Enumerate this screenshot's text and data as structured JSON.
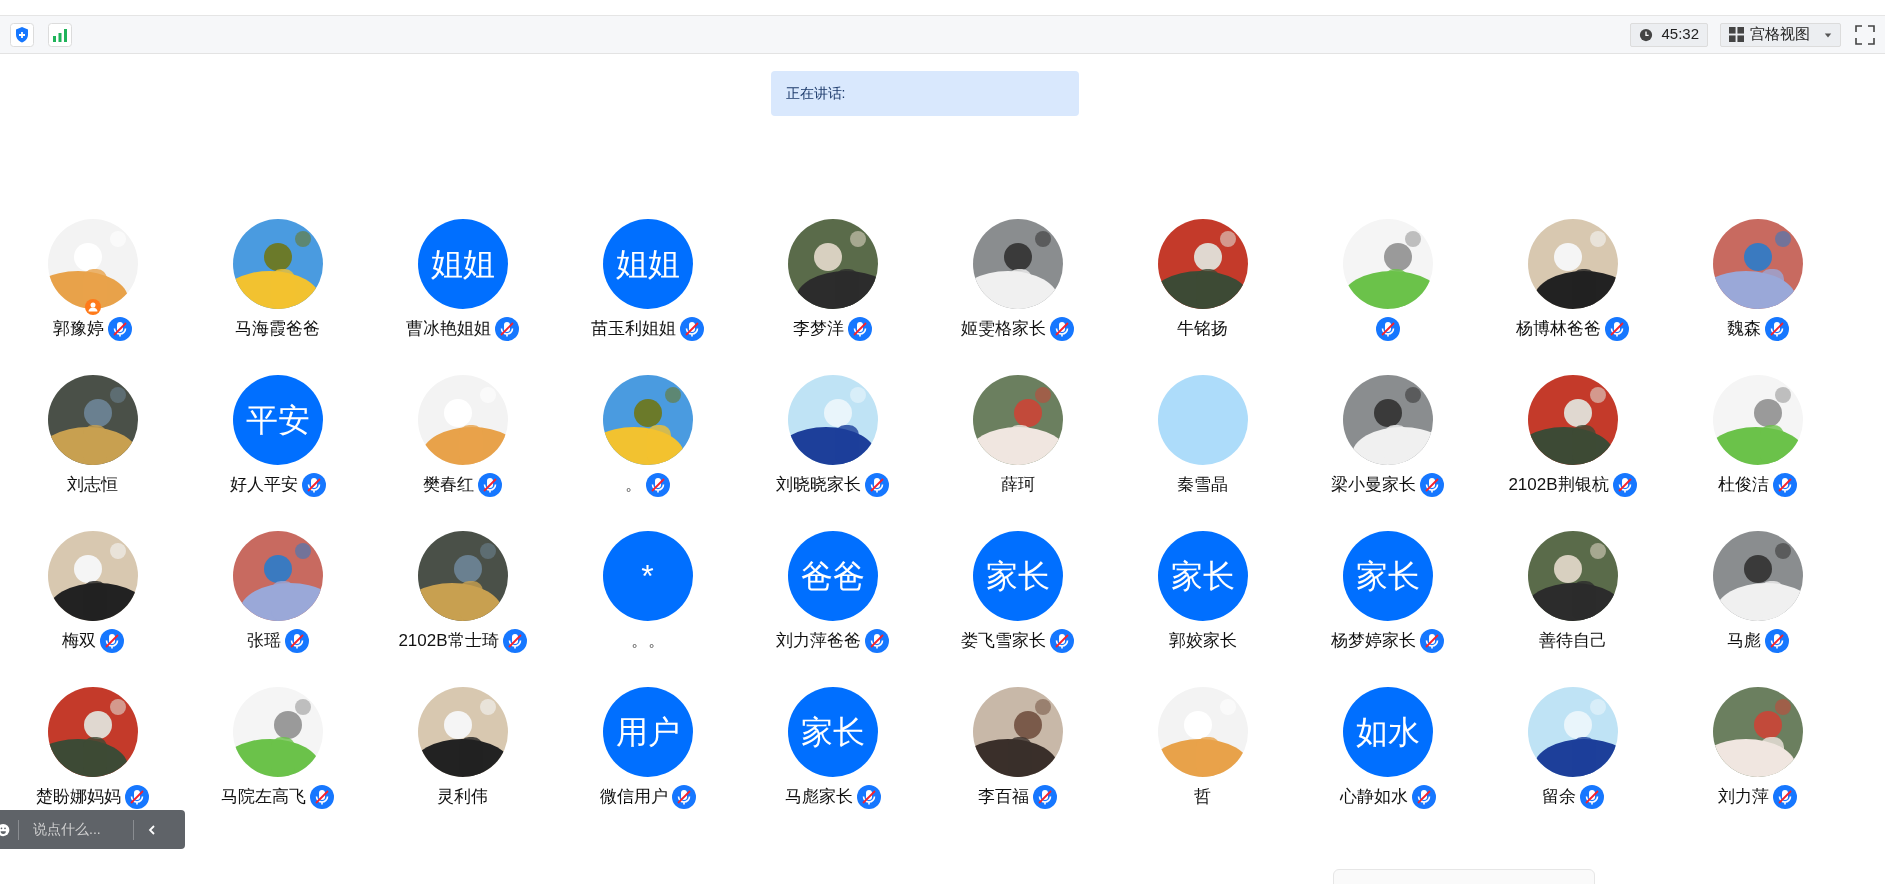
{
  "toolbar": {
    "timer": "45:32",
    "view_button": "宫格视图"
  },
  "speaking": {
    "label": "正在讲话:"
  },
  "participants": [
    {
      "name": "郭豫婷",
      "muted": true,
      "host": true
    },
    {
      "name": "马海霞爸爸",
      "muted": false,
      "host": false
    },
    {
      "name": "曹冰艳姐姐",
      "avatar": {
        "kind": "text",
        "text": "姐姐"
      },
      "muted": true,
      "host": false
    },
    {
      "name": "苗玉利姐姐",
      "avatar": {
        "kind": "text",
        "text": "姐姐"
      },
      "muted": true,
      "host": false
    },
    {
      "name": "李梦洋",
      "muted": true,
      "host": false
    },
    {
      "name": "姬雯格家长",
      "muted": true,
      "host": false
    },
    {
      "name": "牛铭扬",
      "muted": false,
      "host": false
    },
    {
      "muted": true,
      "host": false
    },
    {
      "name": "杨博林爸爸",
      "muted": true,
      "host": false
    },
    {
      "name": "魏森",
      "muted": true,
      "host": false
    },
    {
      "name": "刘志恒",
      "muted": false,
      "host": false
    },
    {
      "name": "好人平安",
      "avatar": {
        "kind": "text",
        "text": "平安"
      },
      "muted": true,
      "host": false
    },
    {
      "name": "樊春红",
      "muted": true,
      "host": false
    },
    {
      "name": "。",
      "muted": true,
      "host": false
    },
    {
      "name": "刘晓晓家长",
      "muted": true,
      "host": false
    },
    {
      "name": "薛珂",
      "muted": false,
      "host": false
    },
    {
      "name": "秦雪晶",
      "avatar": {
        "kind": "plain"
      },
      "muted": false,
      "host": false
    },
    {
      "name": "梁小曼家长",
      "muted": true,
      "host": false
    },
    {
      "name": "2102B荆银杭",
      "muted": true,
      "host": false
    },
    {
      "name": "杜俊洁",
      "muted": true,
      "host": false
    },
    {
      "name": "梅双",
      "muted": true,
      "host": false
    },
    {
      "name": "张瑶",
      "muted": true,
      "host": false
    },
    {
      "name": "2102B常士琦",
      "muted": true,
      "host": false
    },
    {
      "name": "。。",
      "avatar": {
        "kind": "text",
        "text": "*"
      },
      "muted": false,
      "host": false
    },
    {
      "name": "刘力萍爸爸",
      "avatar": {
        "kind": "text",
        "text": "爸爸"
      },
      "muted": true,
      "host": false
    },
    {
      "name": "娄飞雪家长",
      "avatar": {
        "kind": "text",
        "text": "家长"
      },
      "muted": true,
      "host": false
    },
    {
      "name": "郭姣家长",
      "avatar": {
        "kind": "text",
        "text": "家长"
      },
      "muted": false,
      "host": false
    },
    {
      "name": "杨梦婷家长",
      "avatar": {
        "kind": "text",
        "text": "家长"
      },
      "muted": true,
      "host": false
    },
    {
      "name": "善待自己",
      "muted": false,
      "host": false
    },
    {
      "name": "马彪",
      "muted": true,
      "host": false
    },
    {
      "name": "楚盼娜妈妈",
      "muted": true,
      "host": false
    },
    {
      "name": "马院左高飞",
      "muted": true,
      "host": false
    },
    {
      "name": "灵利伟",
      "muted": false,
      "host": false
    },
    {
      "name": "微信用户",
      "avatar": {
        "kind": "text",
        "text": "用户"
      },
      "muted": true,
      "host": false
    },
    {
      "name": "马彪家长",
      "avatar": {
        "kind": "text",
        "text": "家长"
      },
      "muted": true,
      "host": false
    },
    {
      "name": "李百福",
      "muted": true,
      "host": false
    },
    {
      "name": "哲",
      "muted": false,
      "host": false
    },
    {
      "name": "心静如水",
      "avatar": {
        "kind": "text",
        "text": "如水"
      },
      "muted": true,
      "host": false
    },
    {
      "name": "留余",
      "muted": true,
      "host": false
    },
    {
      "name": "刘力萍",
      "muted": true,
      "host": false
    }
  ],
  "chat": {
    "placeholder": "说点什么..."
  }
}
